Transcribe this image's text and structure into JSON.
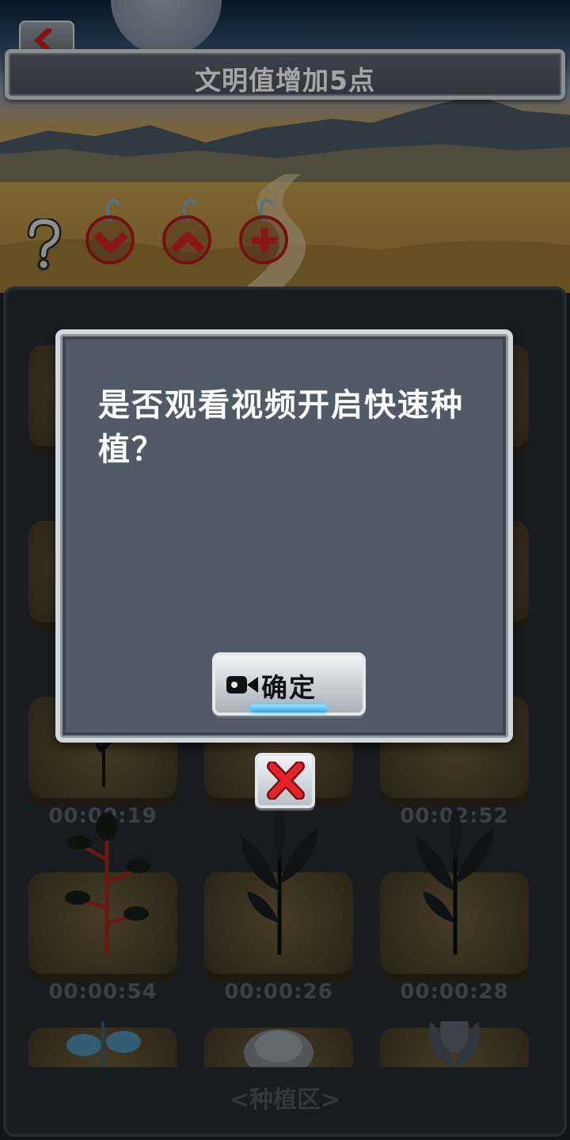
{
  "header": {
    "banner_text": "文明值增加5点"
  },
  "toolbar": {
    "help_icon": "question-mark-icon",
    "tools": [
      {
        "name": "seed-down-tool",
        "icon": "chevron-down-icon"
      },
      {
        "name": "seed-up-tool",
        "icon": "chevron-up-icon"
      },
      {
        "name": "seed-plus-tool",
        "icon": "plus-icon"
      }
    ]
  },
  "plots": {
    "timers": [
      "00:00:19",
      "",
      "00:02:52",
      "00:00:54",
      "00:00:26",
      "00:00:28"
    ]
  },
  "planting_zone": {
    "label": "<种植区>"
  },
  "dialog": {
    "message": "是否观看视频开启快速种植？",
    "confirm_label": "确定",
    "confirm_icon": "video-camera-icon",
    "close_icon": "close-x-icon"
  },
  "colors": {
    "accent_red": "#d42222",
    "dialog_bg": "#515a66",
    "button_glow": "#2fa5e6"
  }
}
